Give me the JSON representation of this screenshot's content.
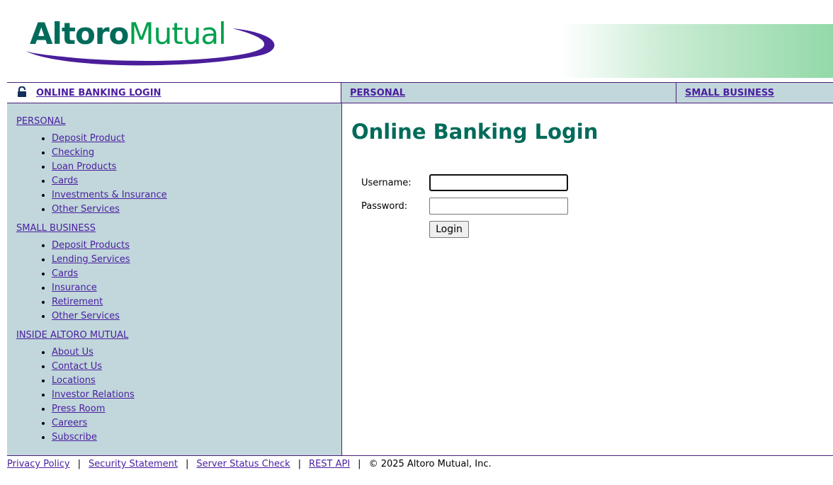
{
  "header": {
    "logo_word1": "Altoro",
    "logo_word2": "Mutual"
  },
  "nav": {
    "login_label": "ONLINE BANKING LOGIN",
    "personal_label": "PERSONAL",
    "business_label": "SMALL BUSINESS"
  },
  "sidebar": {
    "sections": [
      {
        "title": "PERSONAL",
        "items": [
          "Deposit Product",
          "Checking",
          "Loan Products",
          "Cards",
          "Investments & Insurance",
          "Other Services"
        ]
      },
      {
        "title": "SMALL BUSINESS",
        "items": [
          "Deposit Products",
          "Lending Services",
          "Cards",
          "Insurance",
          "Retirement",
          "Other Services"
        ]
      },
      {
        "title": "INSIDE ALTORO MUTUAL",
        "items": [
          "About Us",
          "Contact Us",
          "Locations",
          "Investor Relations",
          "Press Room",
          "Careers",
          "Subscribe"
        ]
      }
    ]
  },
  "main": {
    "title": "Online Banking Login",
    "username_label": "Username:",
    "username_value": "",
    "password_label": "Password:",
    "password_value": "",
    "login_button": "Login"
  },
  "footer": {
    "links": [
      "Privacy Policy",
      "Security Statement",
      "Server Status Check",
      "REST API"
    ],
    "separator": "|",
    "copyright": "© 2025 Altoro Mutual, Inc."
  },
  "colors": {
    "brand_dark_green": "#006b5a",
    "brand_green": "#00a04d",
    "brand_purple": "#4a1e7a",
    "sidebar_bg": "#c1d7db",
    "link": "#4a1ea0"
  },
  "icons": {
    "login_lock": "lock-icon",
    "logo_swoosh": "swoosh-ellipse"
  }
}
